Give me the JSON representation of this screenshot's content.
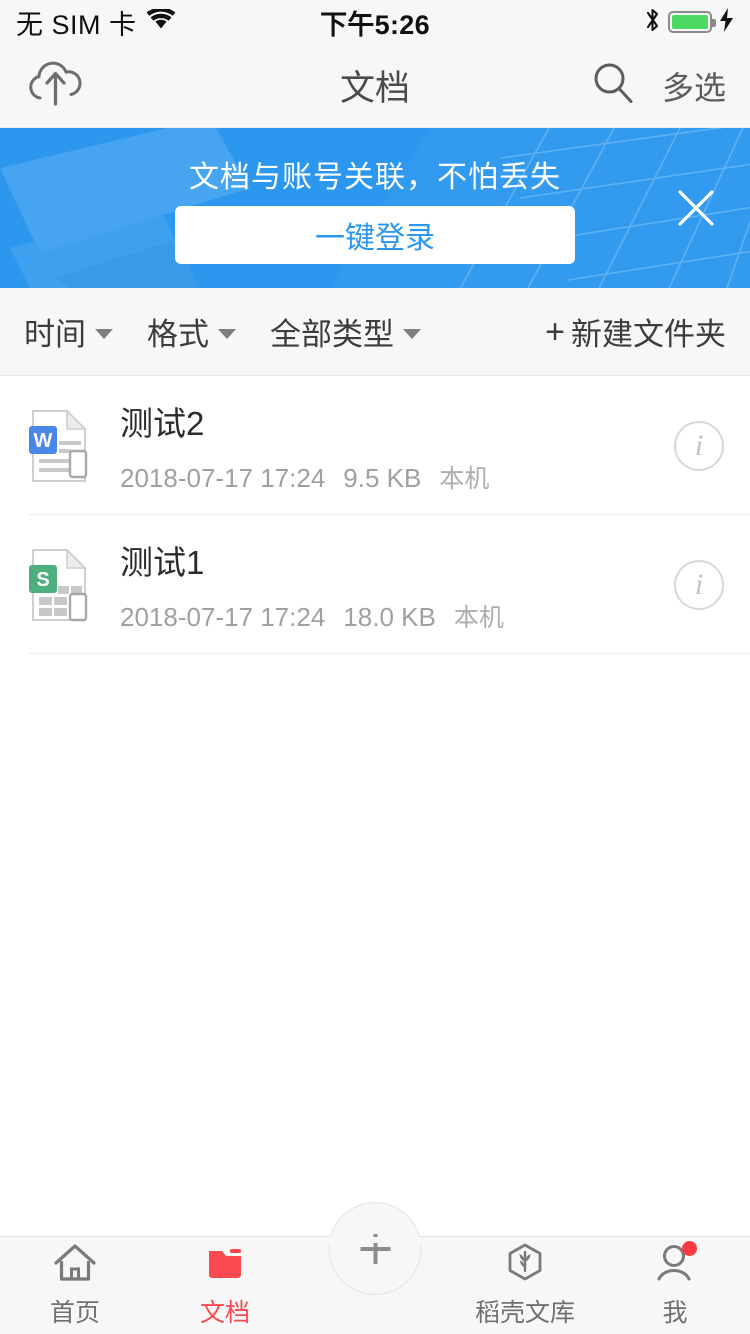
{
  "status_bar": {
    "carrier": "无 SIM 卡",
    "wifi_icon": "wifi-icon",
    "time": "下午5:26",
    "bluetooth_icon": "bluetooth-icon",
    "battery_icon": "battery-full-icon",
    "charging_icon": "charging-bolt-icon",
    "battery_color": "#4cd964"
  },
  "nav_bar": {
    "upload_icon": "cloud-upload-icon",
    "title": "文档",
    "search_icon": "search-icon",
    "multiselect_label": "多选"
  },
  "banner": {
    "message": "文档与账号关联，不怕丢失",
    "button_label": "一键登录",
    "close_icon": "close-icon",
    "bg_color": "#2b97ee",
    "button_text_color": "#2b97ee"
  },
  "filter_bar": {
    "filters": [
      {
        "label": "时间",
        "caret": "chevron-down-icon"
      },
      {
        "label": "格式",
        "caret": "chevron-down-icon"
      },
      {
        "label": "全部类型",
        "caret": "chevron-down-icon"
      }
    ],
    "new_folder": {
      "plus": "+",
      "label": "新建文件夹"
    }
  },
  "files": [
    {
      "name": "测试2",
      "date": "2018-07-17 17:24",
      "size": "9.5 KB",
      "location": "本机",
      "icon": "word-document-icon",
      "icon_letter": "W",
      "icon_color": "#4a86e8",
      "info_icon": "info-icon"
    },
    {
      "name": "测试1",
      "date": "2018-07-17 17:24",
      "size": "18.0 KB",
      "location": "本机",
      "icon": "spreadsheet-document-icon",
      "icon_letter": "S",
      "icon_color": "#4caf7d",
      "info_icon": "info-icon"
    }
  ],
  "tab_bar": {
    "active_color": "#fa4a4f",
    "inactive_color": "#707070",
    "tabs": [
      {
        "label": "首页",
        "icon": "home-icon",
        "active": false
      },
      {
        "label": "文档",
        "icon": "folder-icon",
        "active": true
      },
      {
        "label": "稻壳文库",
        "icon": "docer-hexagon-icon",
        "active": false
      },
      {
        "label": "我",
        "icon": "person-icon",
        "active": false,
        "badge": true
      }
    ],
    "create_button": {
      "icon": "plus-icon"
    }
  }
}
